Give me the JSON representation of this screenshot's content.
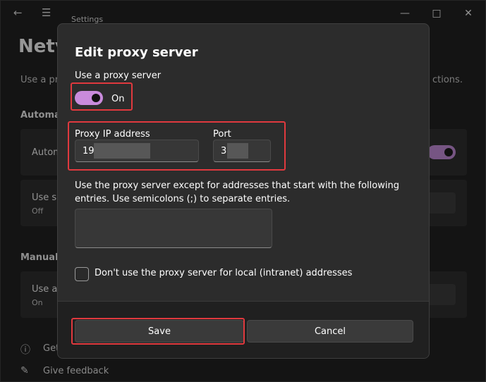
{
  "app": {
    "title": "Settings"
  },
  "background": {
    "heading": "Netv",
    "description": "Use a pr",
    "description_right": "ctions.",
    "section_auto": "Automat",
    "auto_item": "Autom",
    "script_item": "Use se",
    "script_item_sub": "Off",
    "section_manual": "Manual p",
    "manual_item": "Use a",
    "manual_item_sub": "On",
    "footer_help": "Get",
    "footer_feedback": "Give feedback"
  },
  "dialog": {
    "title": "Edit proxy server",
    "use_proxy_label": "Use a proxy server",
    "toggle_state": "On",
    "ip_label": "Proxy IP address",
    "ip_value": "19.",
    "port_label": "Port",
    "port_value": "3",
    "exceptions_text": "Use the proxy server except for addresses that start with the following entries. Use semicolons (;) to separate entries.",
    "local_checkbox_label": "Don't use the proxy server for local (intranet) addresses",
    "save_label": "Save",
    "cancel_label": "Cancel"
  },
  "colors": {
    "accent": "#c98bdc",
    "highlight": "#e0393e",
    "dialog_bg": "#2c2c2c"
  },
  "icons": {
    "back": "back-arrow-icon",
    "menu": "hamburger-menu-icon",
    "minimize": "minimize-icon",
    "maximize": "maximize-icon",
    "close": "close-icon",
    "help": "help-icon",
    "feedback": "feedback-icon"
  }
}
